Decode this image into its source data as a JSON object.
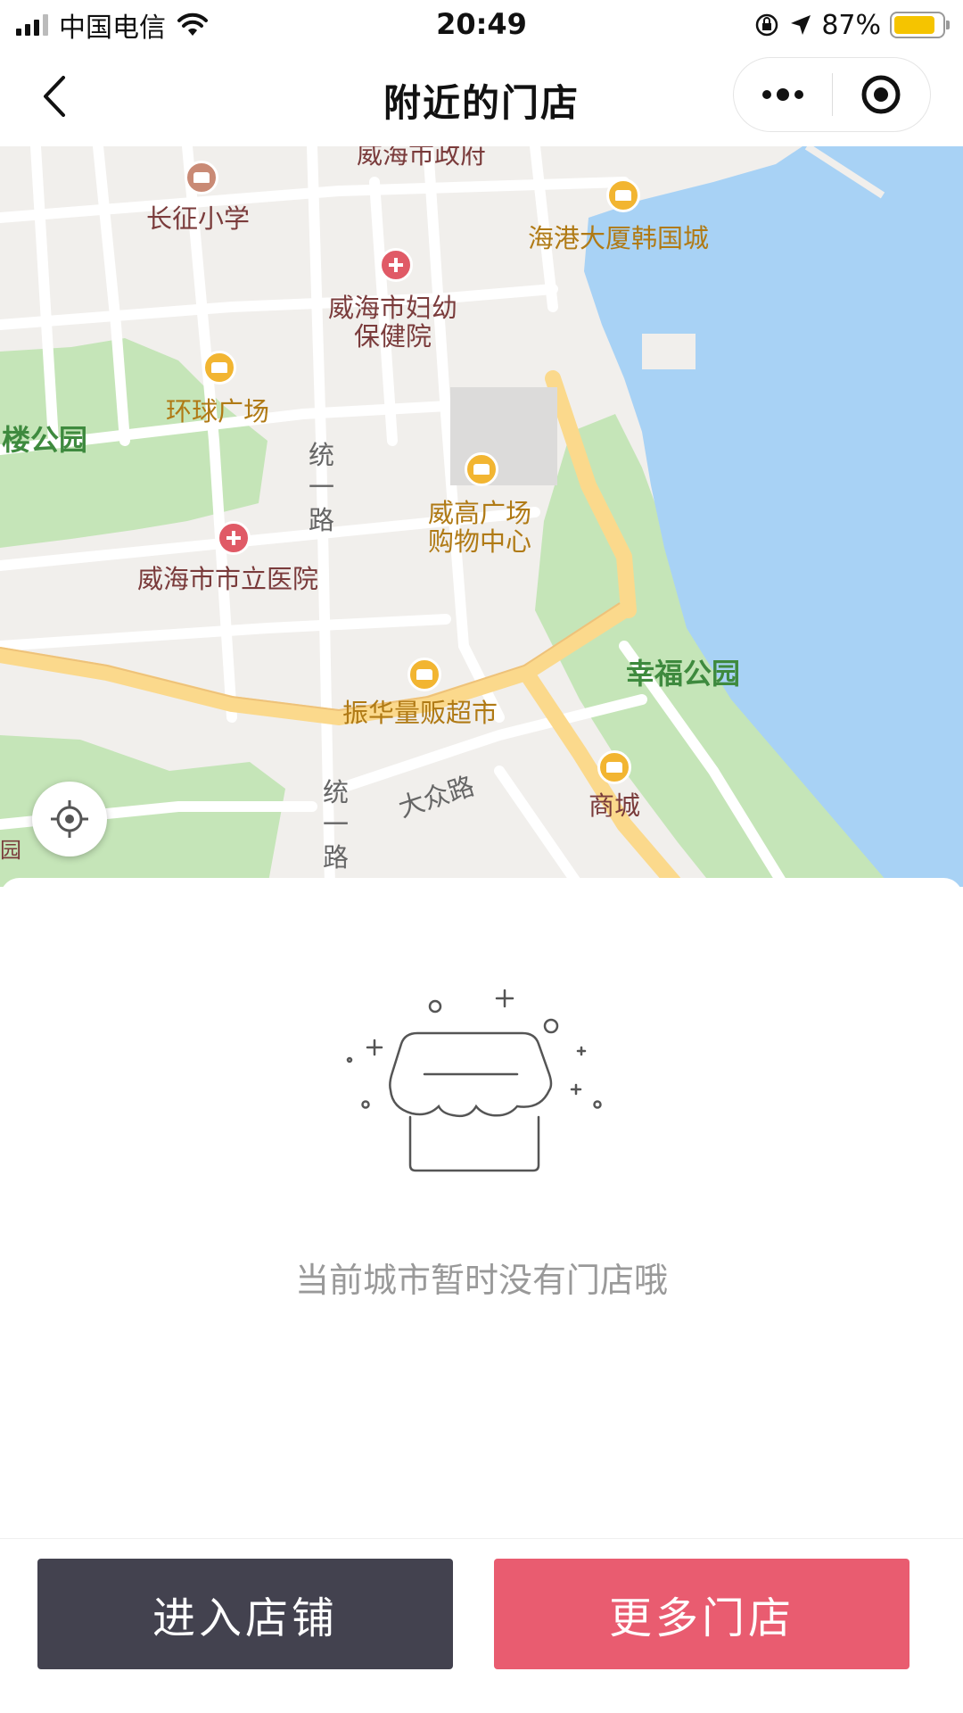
{
  "status_bar": {
    "carrier": "中国电信",
    "time": "20:49",
    "battery_percent_text": "87%",
    "battery_level": 0.87
  },
  "nav": {
    "title": "附近的门店",
    "back_icon": "chevron-left-icon",
    "more_icon": "more-dots-icon",
    "close_icon": "target-circle-icon"
  },
  "map": {
    "labels": {
      "gov": "威海市政府",
      "school": "长征小学",
      "korea_city": "海港大厦韩国城",
      "maternity": "威海市妇幼\n保健院",
      "global_plaza": "环球广场",
      "park_left": "楼公园",
      "tongyi_road_1": "统\n一\n路",
      "weigao": "威高广场\n购物中心",
      "hospital": "威海市市立医院",
      "xingfu_park": "幸福公园",
      "supermarket": "振华量贩超市",
      "tongyi_road_2": "统\n一\n路",
      "dazhong_road": "大众路",
      "mall": "商城",
      "park_edge": "园"
    },
    "locate_icon": "locate-crosshair-icon",
    "colors": {
      "land": "#f1efec",
      "water": "#a8d2f5",
      "park": "#c5e5b8",
      "main_road": "#fbd98c",
      "road": "#ffffff"
    }
  },
  "empty_state": {
    "illustration_icon": "store-awning-icon",
    "message": "当前城市暂时没有门店哦"
  },
  "footer": {
    "enter_store_label": "进入店铺",
    "more_stores_label": "更多门店",
    "enter_color": "#43424f",
    "more_color": "#e95c70"
  }
}
